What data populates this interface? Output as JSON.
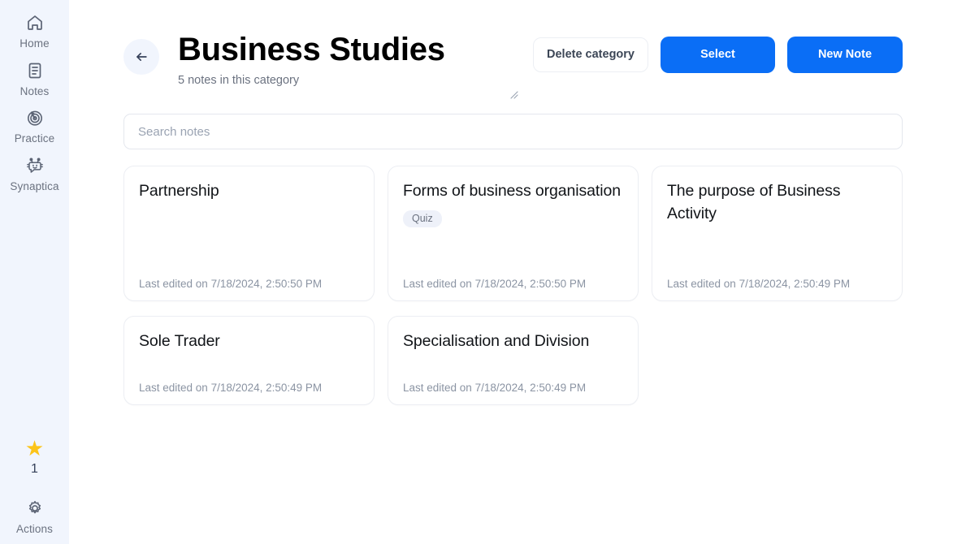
{
  "sidebar": {
    "items": [
      {
        "label": "Home",
        "icon": "home-icon"
      },
      {
        "label": "Notes",
        "icon": "notes-icon"
      },
      {
        "label": "Practice",
        "icon": "target-icon"
      },
      {
        "label": "Synaptica",
        "icon": "robot-icon"
      }
    ],
    "streak": {
      "icon": "star-icon",
      "count": "1"
    },
    "actions": {
      "label": "Actions",
      "icon": "gear-icon"
    }
  },
  "header": {
    "back_icon": "arrow-left-icon",
    "title": "Business Studies",
    "subtitle": "5 notes in this category",
    "resize_handle_icon": "resize-handle-icon",
    "delete_label": "Delete category",
    "select_label": "Select",
    "new_note_label": "New Note"
  },
  "search": {
    "placeholder": "Search notes",
    "value": ""
  },
  "notes": [
    {
      "title": "Partnership",
      "badges": [],
      "meta": "Last edited on 7/18/2024, 2:50:50 PM"
    },
    {
      "title": "Forms of business organisation",
      "badges": [
        "Quiz"
      ],
      "meta": "Last edited on 7/18/2024, 2:50:50 PM"
    },
    {
      "title": "The purpose of Business Activity",
      "badges": [],
      "meta": "Last edited on 7/18/2024, 2:50:49 PM"
    },
    {
      "title": "Sole Trader",
      "badges": [],
      "meta": "Last edited on 7/18/2024, 2:50:49 PM"
    },
    {
      "title": "Specialisation and Division",
      "badges": [],
      "meta": "Last edited on 7/18/2024, 2:50:49 PM"
    }
  ],
  "colors": {
    "accent": "#0a6ef6",
    "sidebar_bg": "#f1f5fd",
    "star": "#fcc419",
    "text_muted": "#6b7280"
  }
}
